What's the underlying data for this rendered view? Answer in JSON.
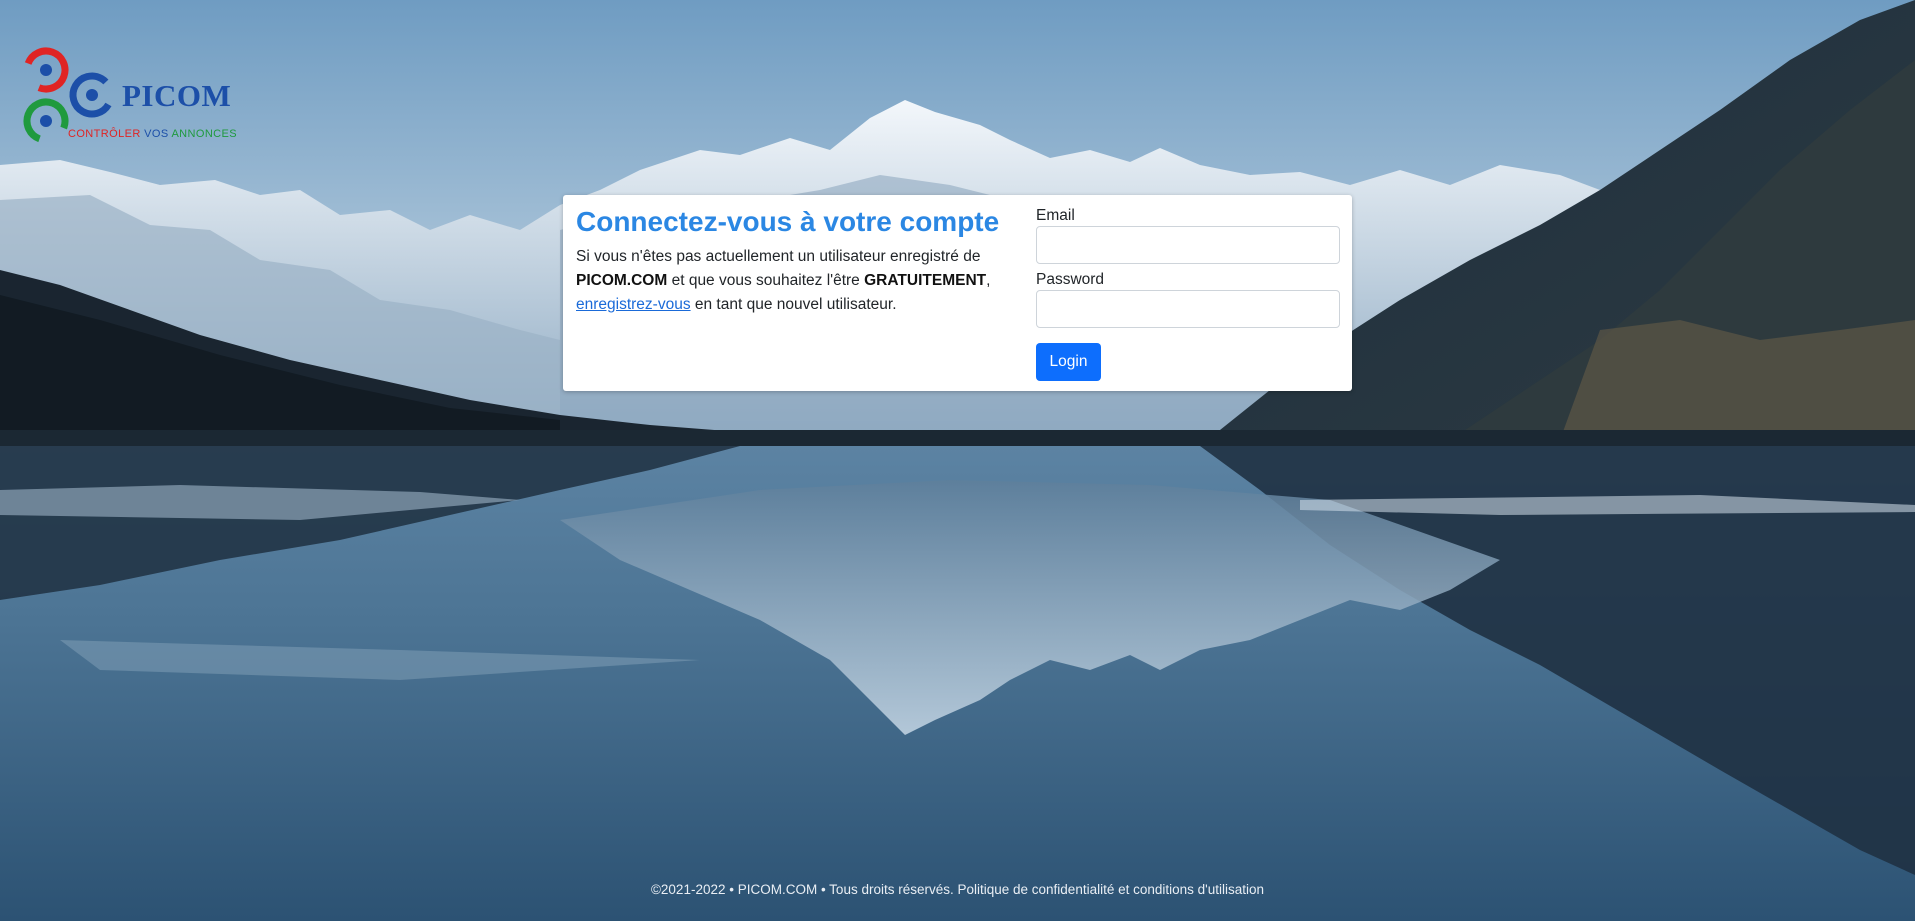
{
  "logo": {
    "name": "PICOM",
    "tagline_part1": "CONTRÔLER",
    "tagline_part2": "VOS",
    "tagline_part3": "ANNONCES",
    "colors": {
      "red": "#e02424",
      "blue": "#1c4fa8",
      "green": "#1f9a3e"
    }
  },
  "login_card": {
    "title": "Connectez-vous à votre compte",
    "desc_text1": "Si vous n'êtes pas actuellement un utilisateur enregistré de ",
    "desc_brand": "PICOM.COM",
    "desc_text2": " et que vous souhaitez l'être ",
    "desc_free": "GRATUITEMENT",
    "desc_text3": ", ",
    "register_link": "enregistrez-vous",
    "desc_text4": " en tant que nouvel utilisateur.",
    "email_label": "Email",
    "email_value": "",
    "password_label": "Password",
    "password_value": "",
    "login_button": "Login",
    "accent_color": "#2b87e3",
    "button_color": "#0d6efd"
  },
  "footer": {
    "text": "©2021-2022 • PICOM.COM • Tous droits réservés. Politique de confidentialité et conditions d'utilisation"
  },
  "background": {
    "sky_color": "#7fa6c6",
    "water_color": "#3f6787",
    "icon": "mountain-lake-image"
  }
}
